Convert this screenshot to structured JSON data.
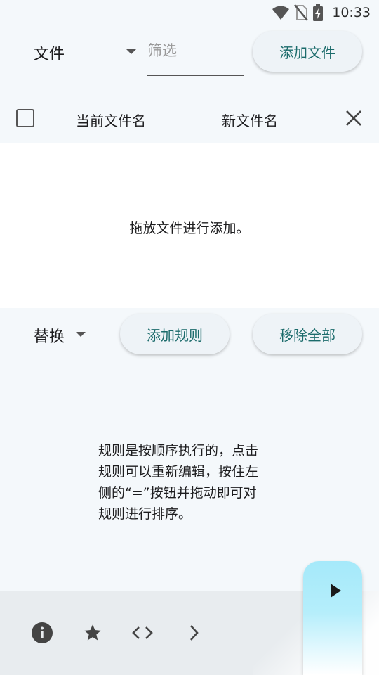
{
  "status_bar": {
    "time": "10:33",
    "icons": [
      "wifi-icon",
      "no-sim-icon",
      "battery-charging-icon"
    ]
  },
  "toolbar": {
    "type_select": "文件",
    "filter_placeholder": "筛选",
    "add_file_label": "添加文件"
  },
  "file_list": {
    "column_current": "当前文件名",
    "column_new": "新文件名",
    "empty_hint": "拖放文件进行添加。"
  },
  "rules": {
    "type_select": "替换",
    "add_rule_label": "添加规则",
    "remove_all_label": "移除全部",
    "hint_lines": [
      "规则是按顺序执行的，点击",
      "规则可以重新编辑，按住左",
      "侧的“=”按钮并拖动即可对",
      "规则进行排序。"
    ]
  },
  "bottom_bar": {
    "icons": [
      "info-icon",
      "star-icon",
      "code-icon",
      "chevron-right-icon"
    ]
  },
  "fab": {
    "icon": "play-icon"
  },
  "colors": {
    "accent_text": "#1b6b6b",
    "background": "#f4f8fb",
    "fab": "#a5e9fa",
    "bottom_bar": "#e8ecef"
  }
}
